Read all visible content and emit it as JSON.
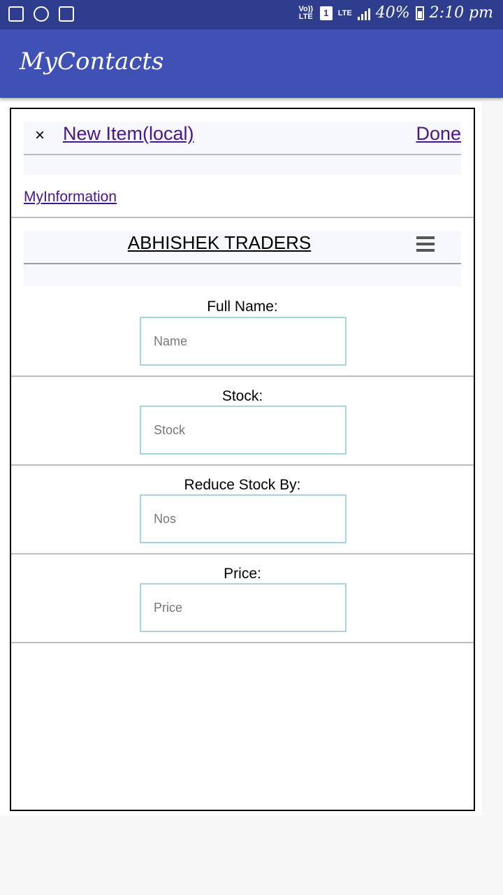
{
  "status_bar": {
    "volte": "Vo)) LTE",
    "sim": "1",
    "lte": "LTE",
    "battery": "40%",
    "time": "2:10 pm",
    "icons": [
      "image-icon",
      "sync-icon",
      "voicemail-icon",
      "signal-icon",
      "battery-icon"
    ]
  },
  "app_bar": {
    "title": "MyContacts"
  },
  "form": {
    "close_label": "×",
    "title": "New Item(local)",
    "done_label": "Done",
    "my_information_link": "MyInformation",
    "company_name": "ABHISHEK TRADERS",
    "fields": [
      {
        "label": "Full Name:",
        "placeholder": "Name"
      },
      {
        "label": "Stock:",
        "placeholder": "Stock"
      },
      {
        "label": "Reduce Stock By:",
        "placeholder": "Nos"
      },
      {
        "label": "Price:",
        "placeholder": "Price"
      }
    ]
  },
  "colors": {
    "status_bar": "#2f3d8f",
    "app_bar": "#3f51b5",
    "link": "#4a148c",
    "input_border": "#a8d4e0"
  }
}
